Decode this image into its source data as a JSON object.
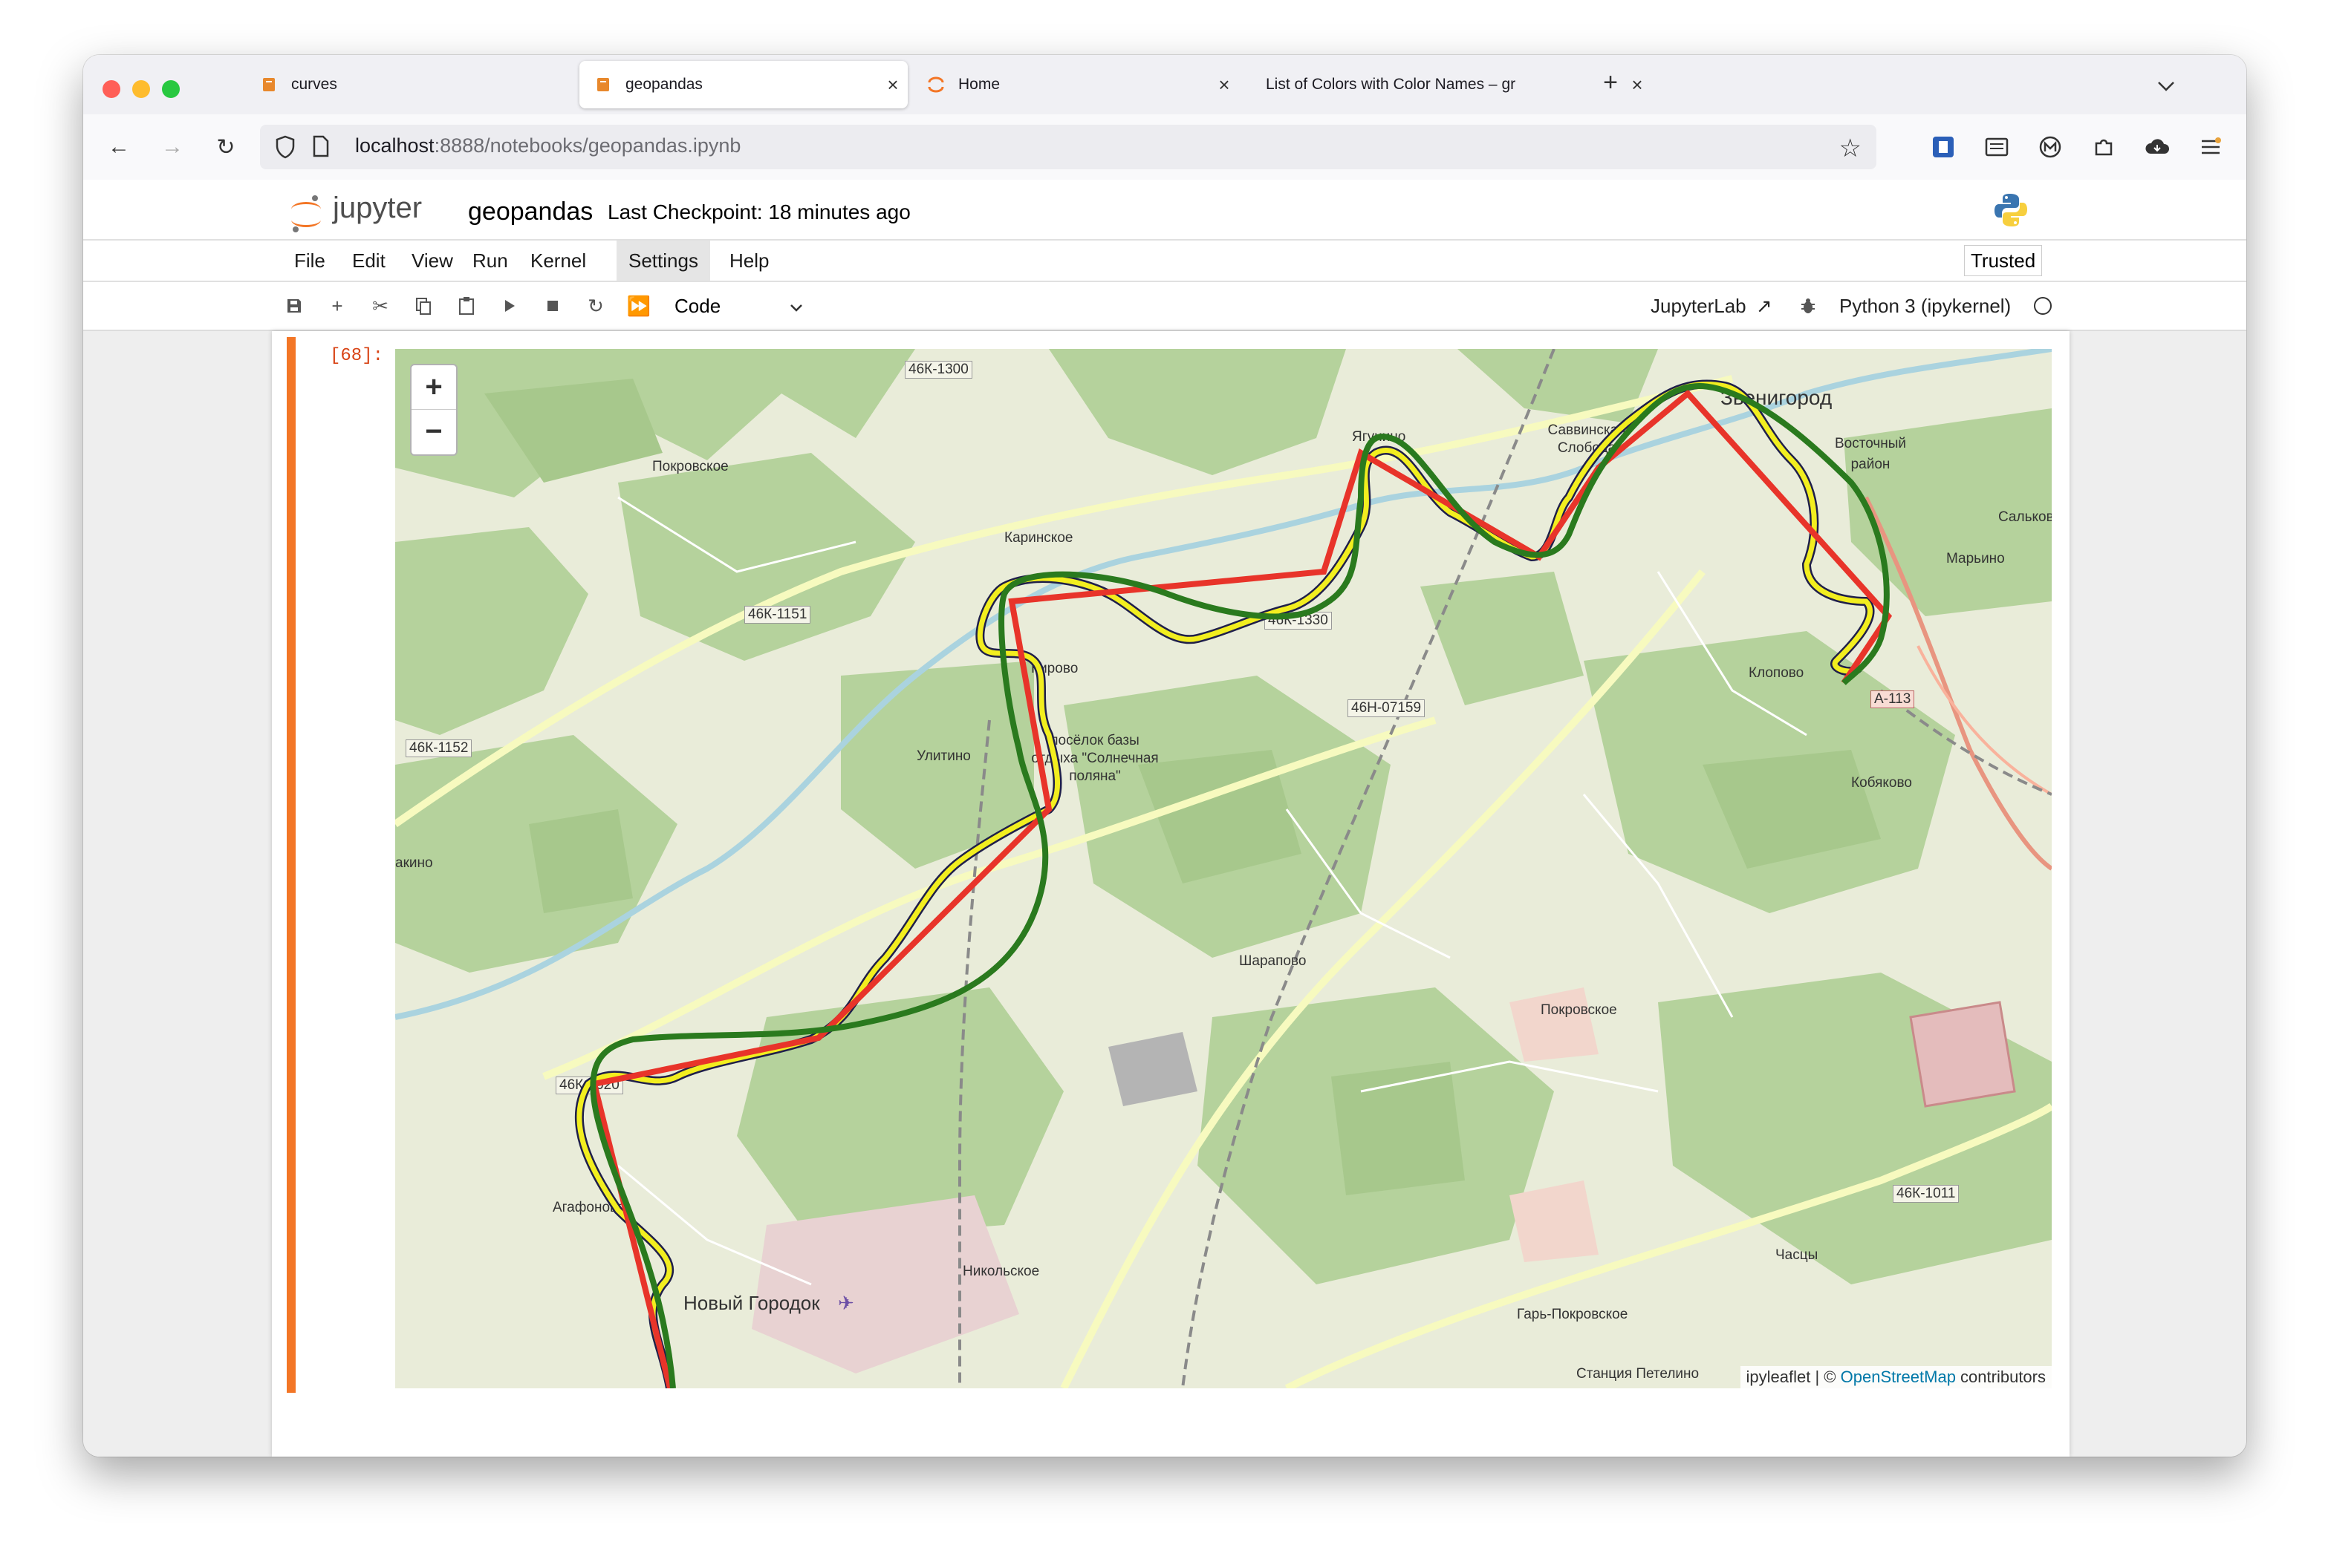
{
  "browser": {
    "tabs": [
      {
        "label": "curves",
        "icon": "notebook-icon",
        "active": false
      },
      {
        "label": "geopandas",
        "icon": "notebook-icon",
        "active": true
      },
      {
        "label": "Home",
        "icon": "jupyter-icon",
        "active": false
      },
      {
        "label": "List of Colors with Color Names – gr",
        "icon": "",
        "active": false
      }
    ],
    "new_tab": "+",
    "url_host": "localhost",
    "url_path": ":8888/notebooks/geopandas.ipynb"
  },
  "jupyter": {
    "logo_text": "jupyter",
    "notebook_name": "geopandas",
    "checkpoint": "Last Checkpoint: 18 minutes ago",
    "menu": [
      "File",
      "Edit",
      "View",
      "Run",
      "Kernel",
      "Settings",
      "Help"
    ],
    "selected_menu": "Settings",
    "trusted": "Trusted",
    "cell_type": "Code",
    "jupyterlab_link": "JupyterLab",
    "kernel": "Python 3 (ipykernel)"
  },
  "cells": {
    "output_prompt": "[68]:",
    "empty_prompt": "[ ]:"
  },
  "map": {
    "zoom_in": "+",
    "zoom_out": "−",
    "attribution_lib": "ipyleaflet",
    "attribution_sep": " | © ",
    "attribution_link": "OpenStreetMap",
    "attribution_tail": " contributors",
    "labels": [
      {
        "text": "46К-1300"
      },
      {
        "text": "Покровское"
      },
      {
        "text": "Каринское"
      },
      {
        "text": "46К-1151"
      },
      {
        "text": "Ягунино"
      },
      {
        "text": "Саввинская Слобода"
      },
      {
        "text": "Звенигород"
      },
      {
        "text": "Восточный район"
      },
      {
        "text": "Сальково"
      },
      {
        "text": "Марьино"
      },
      {
        "text": "46К-1330"
      },
      {
        "text": "Клопово"
      },
      {
        "text": "А-113"
      },
      {
        "text": "Кирово"
      },
      {
        "text": "46Н-07159"
      },
      {
        "text": "Улитино"
      },
      {
        "text": "посёлок базы отдыха \"Солнечная поляна\""
      },
      {
        "text": "46К-1152"
      },
      {
        "text": "Кобяково"
      },
      {
        "text": "Шарапово"
      },
      {
        "text": "Покровское"
      },
      {
        "text": "46К-1020"
      },
      {
        "text": "Агафоново"
      },
      {
        "text": "Новый Городок"
      },
      {
        "text": "Никольское"
      },
      {
        "text": "46К-1011"
      },
      {
        "text": "Часцы"
      },
      {
        "text": "Гарь-Покровское"
      },
      {
        "text": "Станция Петелино"
      },
      {
        "text": "акино"
      }
    ],
    "route_colors": {
      "yellow": "#f2ee1f",
      "red": "#e8342a",
      "green": "#2a7a1e"
    }
  }
}
